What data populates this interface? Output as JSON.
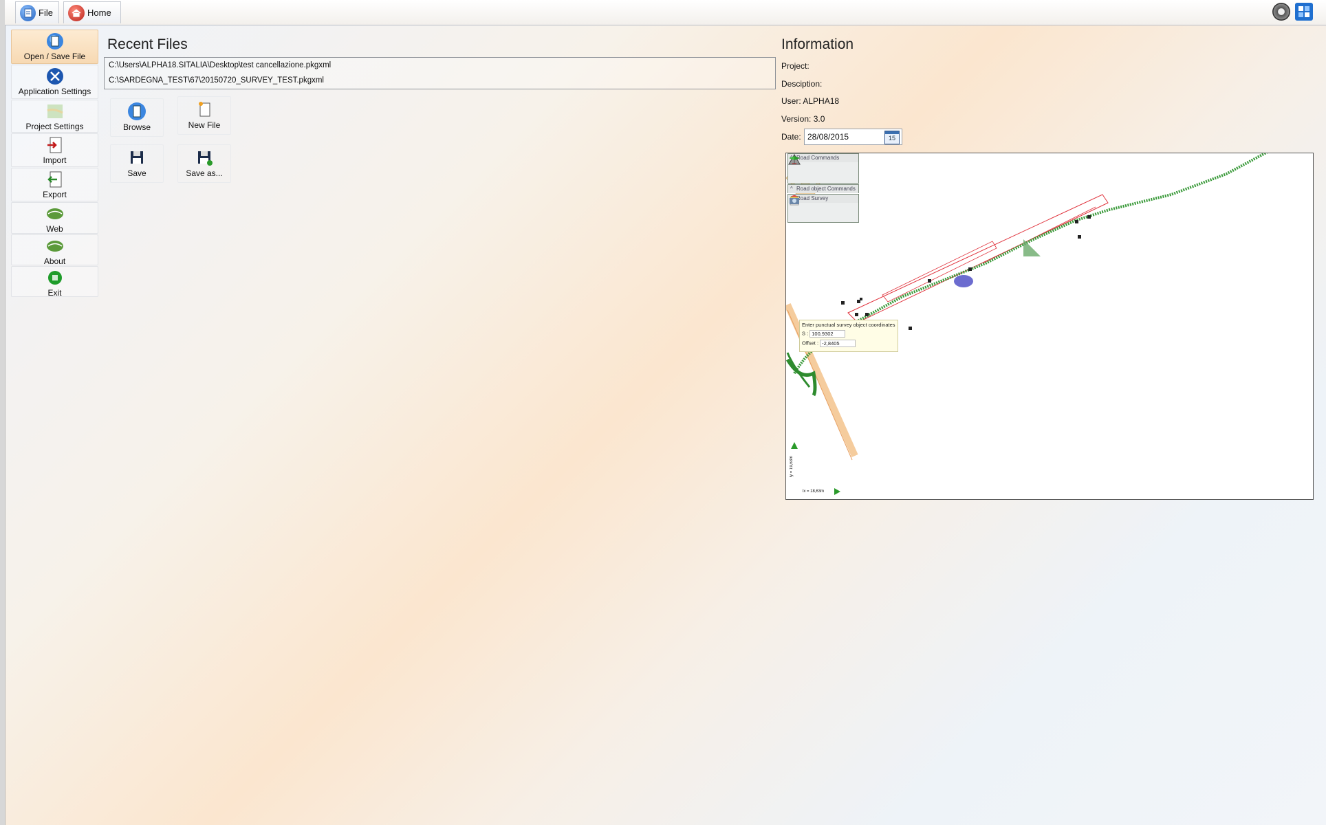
{
  "window": {
    "tabs": [
      {
        "label": "File",
        "icon": "file-icon"
      },
      {
        "label": "Home",
        "icon": "home-icon"
      }
    ],
    "top_right_icons": [
      "gear-icon",
      "fullscreen-icon"
    ]
  },
  "sidebar": {
    "items": [
      {
        "label": "Open / Save File",
        "icon": "open-save-icon",
        "active": true
      },
      {
        "label": "Application Settings",
        "icon": "tools-icon"
      },
      {
        "label": "Project Settings",
        "icon": "map-icon"
      },
      {
        "label": "Import",
        "icon": "import-icon"
      },
      {
        "label": "Export",
        "icon": "export-icon"
      },
      {
        "label": "Web",
        "icon": "web-icon"
      },
      {
        "label": "About",
        "icon": "about-icon"
      },
      {
        "label": "Exit",
        "icon": "exit-icon"
      }
    ]
  },
  "recent": {
    "title": "Recent Files",
    "files": [
      "C:\\Users\\ALPHA18.SITALIA\\Desktop\\test cancellazione.pkgxml",
      "C:\\SARDEGNA_TEST\\67\\20150720_SURVEY_TEST.pkgxml"
    ],
    "actions": [
      {
        "label": "Browse",
        "icon": "browse-icon"
      },
      {
        "label": "New File",
        "icon": "new-file-icon"
      },
      {
        "label": "Save",
        "icon": "save-icon"
      },
      {
        "label": "Save as...",
        "icon": "save-as-icon"
      }
    ]
  },
  "info": {
    "title": "Information",
    "project_label": "Project:",
    "project_value": "",
    "description_label": "Desciption:",
    "description_value": "",
    "user_label": "User:",
    "user_value": "ALPHA18",
    "version_label": "Version:",
    "version_value": "3.0",
    "date_label": "Date:",
    "date_value": "28/08/2015",
    "calendar_day": "15"
  },
  "map": {
    "panels": [
      {
        "title": "Road Commands",
        "icons": [
          "warning-sign-icon",
          "road-sign-icon",
          "flag-icon"
        ]
      },
      {
        "title": "Road object Commands",
        "icons": []
      },
      {
        "title": "Road Survey",
        "icons": [
          "survey-point-icon",
          "survey-object-icon",
          "camera-icon"
        ]
      }
    ],
    "popup": {
      "title": "Enter punctual survey object coordinates",
      "s_label": "S :",
      "s_value": "100,9302",
      "offset_label": "Offset :",
      "offset_value": "-2,8405"
    },
    "scale_y": "ly = 19,63m",
    "scale_x": "lx = 18,63m",
    "colors": {
      "track": "#2e8b2e",
      "corridor": "#e0323c",
      "road": "#f0b070"
    }
  }
}
